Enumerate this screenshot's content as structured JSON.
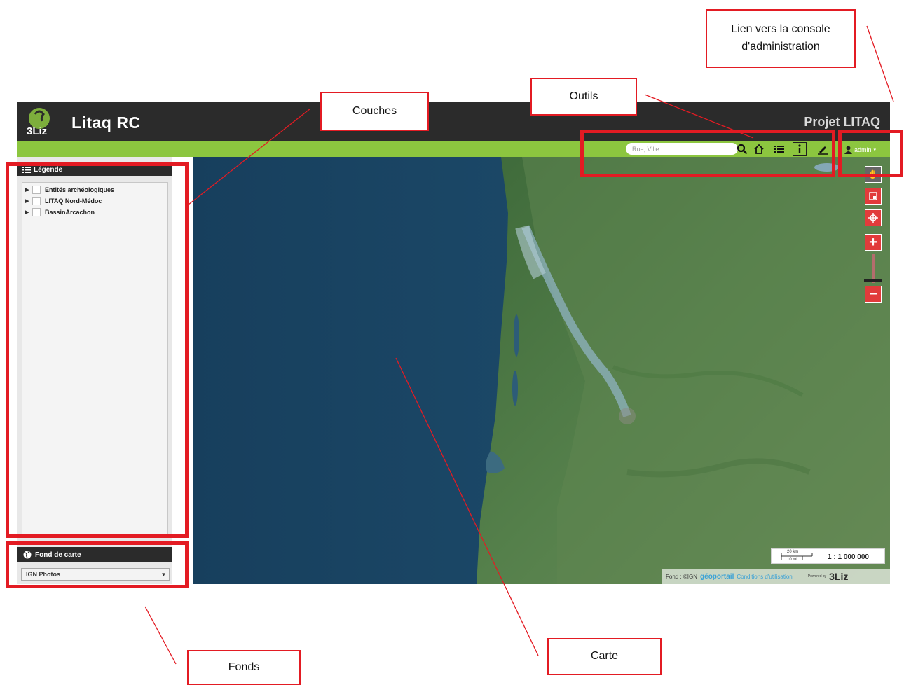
{
  "app": {
    "title": "Litaq RC",
    "logo_text": "3Liz",
    "project_title": "Projet LITAQ"
  },
  "toolbar": {
    "search_placeholder": "Rue, Ville",
    "tools": [
      "search-icon",
      "home-icon",
      "list-icon",
      "info-icon",
      "edit-icon"
    ],
    "user_label": "admin"
  },
  "legend": {
    "header": "Légende",
    "items": [
      {
        "label": "Entités archéologiques"
      },
      {
        "label": "LITAQ Nord-Médoc"
      },
      {
        "label": "BassinArcachon"
      }
    ]
  },
  "basemap": {
    "header": "Fond de carte",
    "selected": "IGN Photos"
  },
  "map": {
    "scale_label": "1 : 1 000 000",
    "scale_km": "20 km",
    "scale_mi": "10 mi",
    "attribution_prefix": "Fond : ©IGN",
    "attribution_geo": "géoportail",
    "attribution_terms": "Conditions d'utilisation",
    "powered_by": "Powered by",
    "credit_logo": "3Liz",
    "controls": [
      "pan-icon",
      "zoom-box-icon",
      "locate-icon",
      "zoom-in-icon",
      "zoom-out-icon"
    ]
  },
  "annotations": {
    "admin_link": "Lien vers la console d'administration",
    "tools": "Outils",
    "layers": "Couches",
    "backgrounds": "Fonds",
    "map": "Carte"
  },
  "colors": {
    "header_bg": "#2b2b2b",
    "accent_green": "#8cc63f",
    "control_red": "#e13b3b",
    "annotation_red": "#e31b23"
  }
}
